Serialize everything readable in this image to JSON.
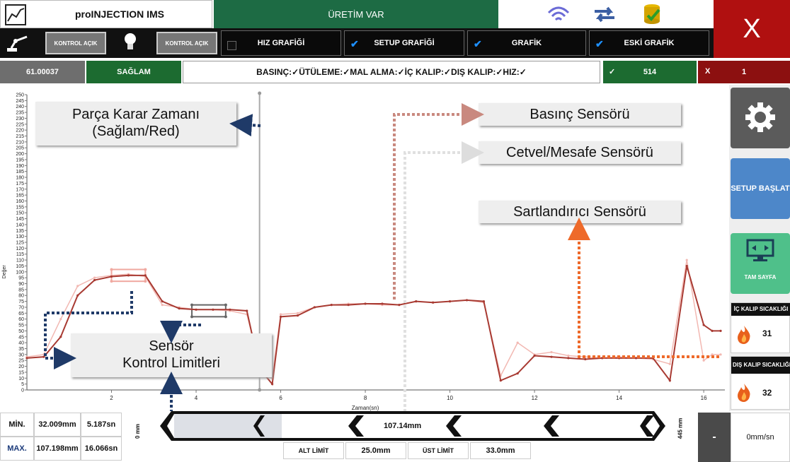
{
  "app": {
    "title": "proINJECTION IMS",
    "status": "ÜRETİM VAR",
    "close_label": "X"
  },
  "controls": {
    "kontrol1": "KONTROL AÇIK",
    "kontrol2": "KONTROL AÇIK"
  },
  "toggles": [
    {
      "label": "HIZ GRAFİĞİ",
      "checked": false
    },
    {
      "label": "SETUP GRAFİĞİ",
      "checked": true
    },
    {
      "label": "GRAFİK",
      "checked": true
    },
    {
      "label": "ESKİ GRAFİK",
      "checked": true
    }
  ],
  "stats": {
    "value": "61.00037",
    "quality": "SAĞLAM",
    "checks": "BASINÇ:✓ÜTÜLEME:✓MAL ALMA:✓İÇ KALIP:✓DIŞ KALIP:✓HIZ:✓",
    "ok_mark": "✓",
    "ok_count": "514",
    "fail_mark": "X",
    "fail_count": "1"
  },
  "sidebar": {
    "setup": "SETUP BAŞLAT",
    "fullscreen": "TAM SAYFA",
    "inner_temp_label": "İÇ KALIP SICAKLIĞI",
    "inner_temp_value": "31",
    "outer_temp_label": "DIŞ KALIP SICAKLIĞI",
    "outer_temp_value": "32"
  },
  "annotations": {
    "decision_line1": "Parça Karar Zamanı",
    "decision_line2": "(Sağlam/Red)",
    "pressure": "Basınç Sensörü",
    "ruler": "Cetvel/Mesafe Sensörü",
    "conditioner": "Sartlandırıcı Sensörü",
    "limits_line1": "Sensör",
    "limits_line2": "Kontrol Limitleri"
  },
  "bottom": {
    "min_label": "MİN.",
    "min_mm": "32.009mm",
    "min_sn": "5.187sn",
    "max_label": "MAX.",
    "max_mm": "107.198mm",
    "max_sn": "16.066sn",
    "left_scale": "0 mm",
    "right_scale": "445 mm",
    "position": "107.14mm",
    "alt_label": "ALT LİMİT",
    "alt_value": "25.0mm",
    "ust_label": "ÜST LİMİT",
    "ust_value": "33.0mm",
    "minus": "-",
    "speed": "0mm/sn"
  },
  "chart_data": {
    "type": "line",
    "xlabel": "Zaman(sn)",
    "ylabel": "Değer",
    "xlim": [
      0,
      16.5
    ],
    "ylim": [
      0,
      250
    ],
    "x_ticks": [
      2,
      4,
      6,
      8,
      10,
      12,
      14,
      16
    ],
    "y_ticks": [
      0,
      5,
      10,
      15,
      20,
      25,
      30,
      35,
      40,
      45,
      50,
      55,
      60,
      65,
      70,
      75,
      80,
      85,
      90,
      95,
      100,
      105,
      110,
      115,
      120,
      125,
      130,
      135,
      140,
      145,
      150,
      155,
      160,
      165,
      170,
      175,
      180,
      185,
      190,
      195,
      200,
      205,
      210,
      215,
      220,
      225,
      230,
      235,
      240,
      245,
      250
    ],
    "decision_time": 5.5,
    "series": [
      {
        "color": "#a83a32",
        "x": [
          0,
          0.4,
          0.8,
          1.2,
          1.6,
          2.0,
          2.4,
          2.8,
          3.2,
          3.6,
          4.0,
          4.4,
          4.8,
          5.2,
          5.5,
          5.8,
          6.0,
          6.4,
          6.8,
          7.2,
          7.6,
          8.0,
          8.4,
          8.8,
          9.2,
          9.6,
          10.0,
          10.4,
          10.8,
          11.2,
          11.6,
          12.0,
          12.4,
          12.8,
          13.2,
          13.6,
          14.0,
          14.4,
          14.8,
          15.2,
          15.6,
          16.0,
          16.2,
          16.4
        ],
        "y": [
          27,
          28,
          45,
          80,
          93,
          96,
          97,
          97,
          75,
          69,
          68,
          68,
          68,
          67,
          18,
          5,
          62,
          63,
          70,
          72,
          72,
          73,
          73,
          72,
          75,
          74,
          75,
          76,
          75,
          8,
          14,
          29,
          28,
          27,
          26,
          27,
          27,
          27,
          27,
          8,
          105,
          55,
          50,
          50
        ]
      },
      {
        "color": "#f2b8b2",
        "x": [
          0,
          0.4,
          0.8,
          1.2,
          1.6,
          2.0,
          2.4,
          2.8,
          3.2,
          3.6,
          4.0,
          4.4,
          4.8,
          5.2,
          5.5,
          5.8,
          6.0,
          6.4,
          6.8,
          7.2,
          7.6,
          8.0,
          8.4,
          8.8,
          9.2,
          9.6,
          10.0,
          10.4,
          10.8,
          11.2,
          11.6,
          12.0,
          12.4,
          12.8,
          13.2,
          13.6,
          14.0,
          14.4,
          14.8,
          15.2,
          15.6,
          16.0,
          16.2,
          16.4
        ],
        "y": [
          28,
          30,
          60,
          88,
          95,
          97,
          98,
          96,
          72,
          70,
          68,
          68,
          67,
          64,
          22,
          10,
          64,
          65,
          70,
          72,
          73,
          73,
          72,
          72,
          75,
          74,
          75,
          76,
          74,
          12,
          40,
          30,
          32,
          29,
          28,
          27,
          28,
          27,
          26,
          22,
          110,
          25,
          30,
          30
        ]
      }
    ],
    "limit_boxes": [
      {
        "x0": 2.0,
        "x1": 2.8,
        "y0": 92,
        "y1": 102,
        "color": "#f0a8a0"
      },
      {
        "x0": 3.9,
        "x1": 4.7,
        "y0": 62,
        "y1": 72,
        "color": "#666666"
      }
    ]
  }
}
